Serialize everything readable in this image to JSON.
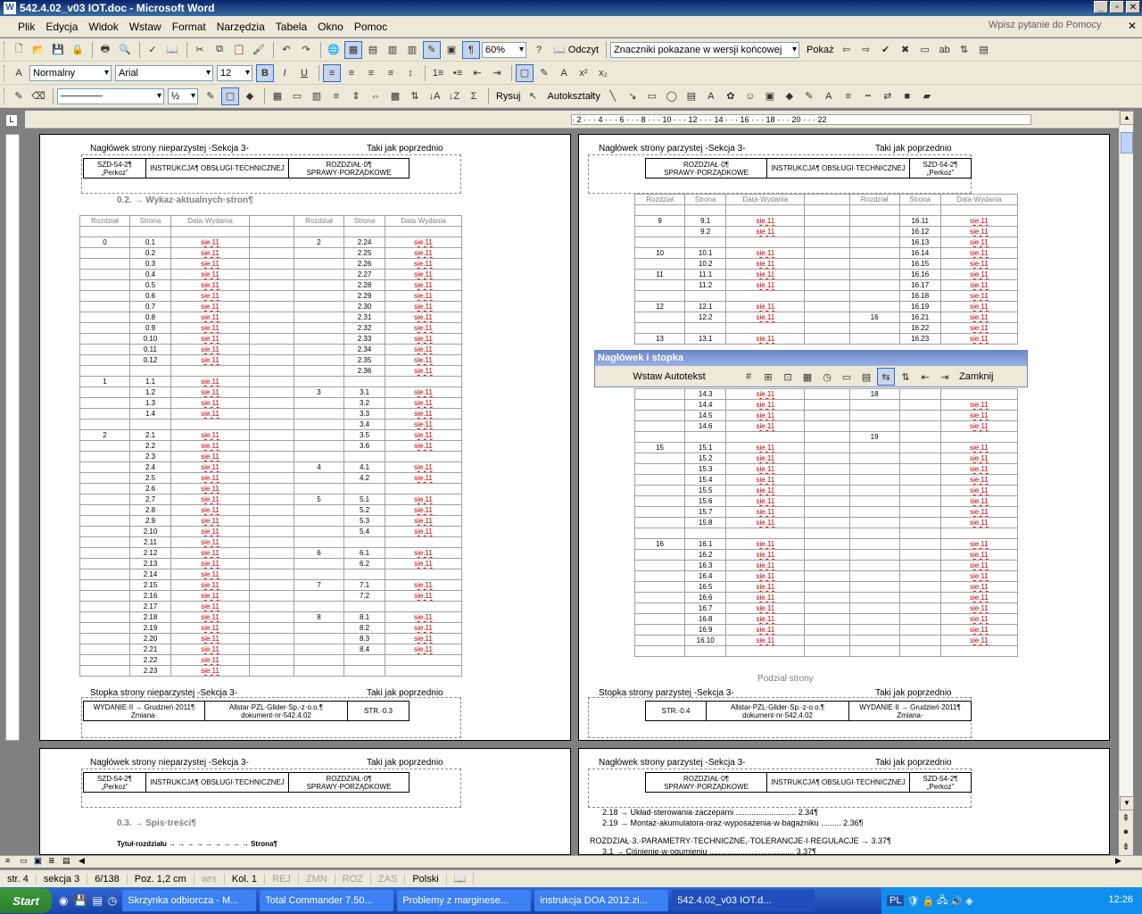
{
  "window": {
    "title": "542.4.02_v03 IOT.doc - Microsoft Word",
    "min": "_",
    "max": "▫",
    "close": "✕"
  },
  "menu": {
    "items": [
      "Plik",
      "Edycja",
      "Widok",
      "Wstaw",
      "Format",
      "Narzędzia",
      "Tabela",
      "Okno",
      "Pomoc"
    ],
    "help_placeholder": "Wpisz pytanie do Pomocy",
    "close": "✕"
  },
  "toolbar_std": {
    "zoom": "60%",
    "read": "Odczyt",
    "markup": "Znaczniki pokazane w wersji końcowej",
    "show": "Pokaż"
  },
  "toolbar_fmt": {
    "style": "Normalny",
    "font": "Arial",
    "size": "12",
    "bold": "B",
    "italic": "I",
    "underline": "U"
  },
  "toolbar_draw": {
    "line_width": "½",
    "draw": "Rysuj",
    "autoshapes": "Autokształty"
  },
  "ruler": {
    "marks": "· 2 · · · 4 · · · 6 · · · 8 · · · 10 · · · 12 · · · 14 · · · 16 · · · 18 · · · 20 · · · 22"
  },
  "page_left": {
    "header_label": "Nagłówek strony nieparzystej -Sekcja 3-",
    "same_as_prev": "Taki jak poprzednio",
    "hdr_cells": [
      "SZD-54-2¶ „Perkoz”",
      "INSTRUKCJA¶ OBSŁUGI·TECHNICZNEJ",
      "ROZDZIAŁ·0¶ SPRAWY·PORZĄDKOWE"
    ],
    "section": "0.2. → Wykaz·aktualnych·stron¶",
    "footer_label": "Stopka strony nieparzystej -Sekcja 3-",
    "footer_cells": [
      "WYDANIE·II → Grudzień·2011¶ Zmiana·",
      "Allstar·PZL·Glider·Sp.·z·o.o.¶ dokument·nr·542.4.02",
      "STR.·0.3"
    ]
  },
  "page_right": {
    "header_label": "Nagłówek strony parzystej -Sekcja 3-",
    "same_as_prev": "Taki jak poprzednio",
    "hdr_cells": [
      "ROZDZIAŁ·0¶ SPRAWY·PORZĄDKOWE",
      "INSTRUKCJA¶ OBSŁUGI·TECHNICZNEJ",
      "SZD-54-2¶ „Perkoz”"
    ],
    "page_break": "Podział strony",
    "footer_label": "Stopka strony parzystej -Sekcja 3-",
    "footer_cells": [
      "STR.·0.4",
      "Allstar·PZL·Glider·Sp.·z·o.o.¶ dokument·nr·542.4.02",
      "WYDANIE·II → Grudzień·2011¶ Zmiana·"
    ]
  },
  "page_left2": {
    "header_label": "Nagłówek strony nieparzystej -Sekcja 3-",
    "same_as_prev": "Taki jak poprzednio",
    "section": "0.3. → Spis·treści¶",
    "toc_head": "Tytuł·rozdziału → → → → → → → → → Strona¶"
  },
  "page_right2": {
    "header_label": "Nagłówek strony parzystej -Sekcja 3-",
    "same_as_prev": "Taki jak poprzednio",
    "lines": [
      "2.18 → Układ·sterowania·zaczepami ........................... 2.34¶",
      "2.19 → Montaż·akumulatora·oraz·wyposażenia·w·bagażniku ......... 2.36¶",
      "ROZDZIAŁ·3.·PARAMETRY·TECHNICZNE,·TOLERANCJE·I·REGULACJE → 3.37¶",
      "3.1 → Ciśnienie·w·ogumieniu ...................................... 3.37¶"
    ]
  },
  "table_headers": [
    "Rozdział",
    "Strona",
    "Data·Wydania",
    "",
    "Rozdział",
    "Strona",
    "Data·Wydania"
  ],
  "sie": "sie.11",
  "left_rows": [
    [
      "",
      "",
      "",
      "",
      "",
      "",
      ""
    ],
    [
      "0",
      "0.1",
      "sie.11",
      "",
      "2",
      "2.24",
      "sie.11"
    ],
    [
      "",
      "0.2",
      "sie.11",
      "",
      "",
      "2.25",
      "sie.11"
    ],
    [
      "",
      "0.3",
      "sie.11",
      "",
      "",
      "2.26",
      "sie.11"
    ],
    [
      "",
      "0.4",
      "sie.11",
      "",
      "",
      "2.27",
      "sie.11"
    ],
    [
      "",
      "0.5",
      "sie.11",
      "",
      "",
      "2.28",
      "sie.11"
    ],
    [
      "",
      "0.6",
      "sie.11",
      "",
      "",
      "2.29",
      "sie.11"
    ],
    [
      "",
      "0.7",
      "sie.11",
      "",
      "",
      "2.30",
      "sie.11"
    ],
    [
      "",
      "0.8",
      "sie.11",
      "",
      "",
      "2.31",
      "sie.11"
    ],
    [
      "",
      "0.9",
      "sie.11",
      "",
      "",
      "2.32",
      "sie.11"
    ],
    [
      "",
      "0.10",
      "sie.11",
      "",
      "",
      "2.33",
      "sie.11"
    ],
    [
      "",
      "0.11",
      "sie.11",
      "",
      "",
      "2.34",
      "sie.11"
    ],
    [
      "",
      "0.12",
      "sie.11",
      "",
      "",
      "2.35",
      "sie.11"
    ],
    [
      "",
      "",
      "",
      "",
      "",
      "2.36",
      "sie.11"
    ],
    [
      "1",
      "1.1",
      "sie.11",
      "",
      "",
      "",
      ""
    ],
    [
      "",
      "1.2",
      "sie.11",
      "",
      "3",
      "3.1",
      "sie.11"
    ],
    [
      "",
      "1.3",
      "sie.11",
      "",
      "",
      "3.2",
      "sie.11"
    ],
    [
      "",
      "1.4",
      "sie.11",
      "",
      "",
      "3.3",
      "sie.11"
    ],
    [
      "",
      "",
      "",
      "",
      "",
      "3.4",
      "sie.11"
    ],
    [
      "2",
      "2.1",
      "sie.11",
      "",
      "",
      "3.5",
      "sie.11"
    ],
    [
      "",
      "2.2",
      "sie.11",
      "",
      "",
      "3.6",
      "sie.11"
    ],
    [
      "",
      "2.3",
      "sie.11",
      "",
      "",
      "",
      ""
    ],
    [
      "",
      "2.4",
      "sie.11",
      "",
      "4",
      "4.1",
      "sie.11"
    ],
    [
      "",
      "2.5",
      "sie.11",
      "",
      "",
      "4.2",
      "sie.11"
    ],
    [
      "",
      "2.6",
      "sie.11",
      "",
      "",
      "",
      ""
    ],
    [
      "",
      "2.7",
      "sie.11",
      "",
      "5",
      "5.1",
      "sie.11"
    ],
    [
      "",
      "2.8",
      "sie.11",
      "",
      "",
      "5.2",
      "sie.11"
    ],
    [
      "",
      "2.9",
      "sie.11",
      "",
      "",
      "5.3",
      "sie.11"
    ],
    [
      "",
      "2.10",
      "sie.11",
      "",
      "",
      "5.4",
      "sie.11"
    ],
    [
      "",
      "2.11",
      "sie.11",
      "",
      "",
      "",
      ""
    ],
    [
      "",
      "2.12",
      "sie.11",
      "",
      "6",
      "6.1",
      "sie.11"
    ],
    [
      "",
      "2.13",
      "sie.11",
      "",
      "",
      "6.2",
      "sie.11"
    ],
    [
      "",
      "2.14",
      "sie.11",
      "",
      "",
      "",
      ""
    ],
    [
      "",
      "2.15",
      "sie.11",
      "",
      "7",
      "7.1",
      "sie.11"
    ],
    [
      "",
      "2.16",
      "sie.11",
      "",
      "",
      "7.2",
      "sie.11"
    ],
    [
      "",
      "2.17",
      "sie.11",
      "",
      "",
      "",
      ""
    ],
    [
      "",
      "2.18",
      "sie.11",
      "",
      "8",
      "8.1",
      "sie.11"
    ],
    [
      "",
      "2.19",
      "sie.11",
      "",
      "",
      "8.2",
      "sie.11"
    ],
    [
      "",
      "2.20",
      "sie.11",
      "",
      "",
      "8.3",
      "sie.11"
    ],
    [
      "",
      "2.21",
      "sie.11",
      "",
      "",
      "8.4",
      "sie.11"
    ],
    [
      "",
      "2.22",
      "sie.11",
      "",
      "",
      "",
      ""
    ],
    [
      "",
      "2.23",
      "sie.11",
      "",
      "",
      "",
      ""
    ]
  ],
  "right_rows_top": [
    [
      "",
      "",
      "",
      "",
      "",
      "",
      ""
    ],
    [
      "9",
      "9.1",
      "sie.11",
      "",
      "",
      "16.11",
      "sie.11"
    ],
    [
      "",
      "9.2",
      "sie.11",
      "",
      "",
      "16.12",
      "sie.11"
    ],
    [
      "",
      "",
      "",
      "",
      "",
      "16.13",
      "sie.11"
    ],
    [
      "10",
      "10.1",
      "sie.11",
      "",
      "",
      "16.14",
      "sie.11"
    ],
    [
      "",
      "10.2",
      "sie.11",
      "",
      "",
      "16.15",
      "sie.11"
    ],
    [
      "11",
      "11.1",
      "sie.11",
      "",
      "",
      "16.16",
      "sie.11"
    ],
    [
      "",
      "11.2",
      "sie.11",
      "",
      "",
      "16.17",
      "sie.11"
    ],
    [
      "",
      "",
      "",
      "",
      "",
      "16.18",
      "sie.11"
    ],
    [
      "12",
      "12.1",
      "sie.11",
      "",
      "",
      "16.19",
      "sie.11"
    ],
    [
      "",
      "12.2",
      "sie.11",
      "",
      "16",
      "16.21",
      "sie.11"
    ],
    [
      "",
      "",
      "",
      "",
      "",
      "16.22",
      "sie.11"
    ],
    [
      "13",
      "13.1",
      "sie.11",
      "",
      "",
      "16.23",
      "sie.11"
    ]
  ],
  "right_rows_bottom": [
    [
      "",
      "14.3",
      "sie.11",
      "",
      "18",
      "",
      ""
    ],
    [
      "",
      "14.4",
      "sie.11",
      "",
      "",
      "",
      "sie.11"
    ],
    [
      "",
      "14.5",
      "sie.11",
      "",
      "",
      "",
      "sie.11"
    ],
    [
      "",
      "14.6",
      "sie.11",
      "",
      "",
      "",
      "sie.11"
    ],
    [
      "",
      "",
      "",
      "",
      "19",
      "",
      ""
    ],
    [
      "15",
      "15.1",
      "sie.11",
      "",
      "",
      "",
      "sie.11"
    ],
    [
      "",
      "15.2",
      "sie.11",
      "",
      "",
      "",
      "sie.11"
    ],
    [
      "",
      "15.3",
      "sie.11",
      "",
      "",
      "",
      "sie.11"
    ],
    [
      "",
      "15.4",
      "sie.11",
      "",
      "",
      "",
      "sie.11"
    ],
    [
      "",
      "15.5",
      "sie.11",
      "",
      "",
      "",
      "sie.11"
    ],
    [
      "",
      "15.6",
      "sie.11",
      "",
      "",
      "",
      "sie.11"
    ],
    [
      "",
      "15.7",
      "sie.11",
      "",
      "",
      "",
      "sie.11"
    ],
    [
      "",
      "15.8",
      "sie.11",
      "",
      "",
      "",
      "sie.11"
    ],
    [
      "",
      "",
      "",
      "",
      "",
      "",
      ""
    ],
    [
      "16",
      "16.1",
      "sie.11",
      "",
      "",
      "",
      "sie.11"
    ],
    [
      "",
      "16.2",
      "sie.11",
      "",
      "",
      "",
      "sie.11"
    ],
    [
      "",
      "16.3",
      "sie.11",
      "",
      "",
      "",
      "sie.11"
    ],
    [
      "",
      "16.4",
      "sie.11",
      "",
      "",
      "",
      "sie.11"
    ],
    [
      "",
      "16.5",
      "sie.11",
      "",
      "",
      "",
      "sie.11"
    ],
    [
      "",
      "16.6",
      "sie.11",
      "",
      "",
      "",
      "sie.11"
    ],
    [
      "",
      "16.7",
      "sie.11",
      "",
      "",
      "",
      "sie.11"
    ],
    [
      "",
      "16.8",
      "sie.11",
      "",
      "",
      "",
      "sie.11"
    ],
    [
      "",
      "16.9",
      "sie.11",
      "",
      "",
      "",
      "sie.11"
    ],
    [
      "",
      "16.10",
      "sie.11",
      "",
      "",
      "",
      "sie.11"
    ],
    [
      "",
      "",
      "",
      "",
      "",
      "",
      ""
    ]
  ],
  "header_footer_toolbar": {
    "title": "Nagłówek i stopka",
    "insert_autotext": "Wstaw Autotekst",
    "close": "Zamknij"
  },
  "status": {
    "page": "str. 4",
    "section": "sekcja 3",
    "pages": "6/138",
    "pos": "Poz. 1,2 cm",
    "line": "wrs",
    "col": "Kol. 1",
    "rec": "REJ",
    "trk": "ZMN",
    "ext": "ROZ",
    "ovr": "ZAS",
    "lang": "Polski"
  },
  "taskbar": {
    "start": "Start",
    "tasks": [
      "Skrzynka odbiorcza - M...",
      "Total Commander 7.50...",
      "Problemy z marginese...",
      "instrukcja DOA 2012.zi...",
      "542.4.02_v03 IOT.d..."
    ],
    "lang": "PL",
    "clock": "12:26"
  }
}
